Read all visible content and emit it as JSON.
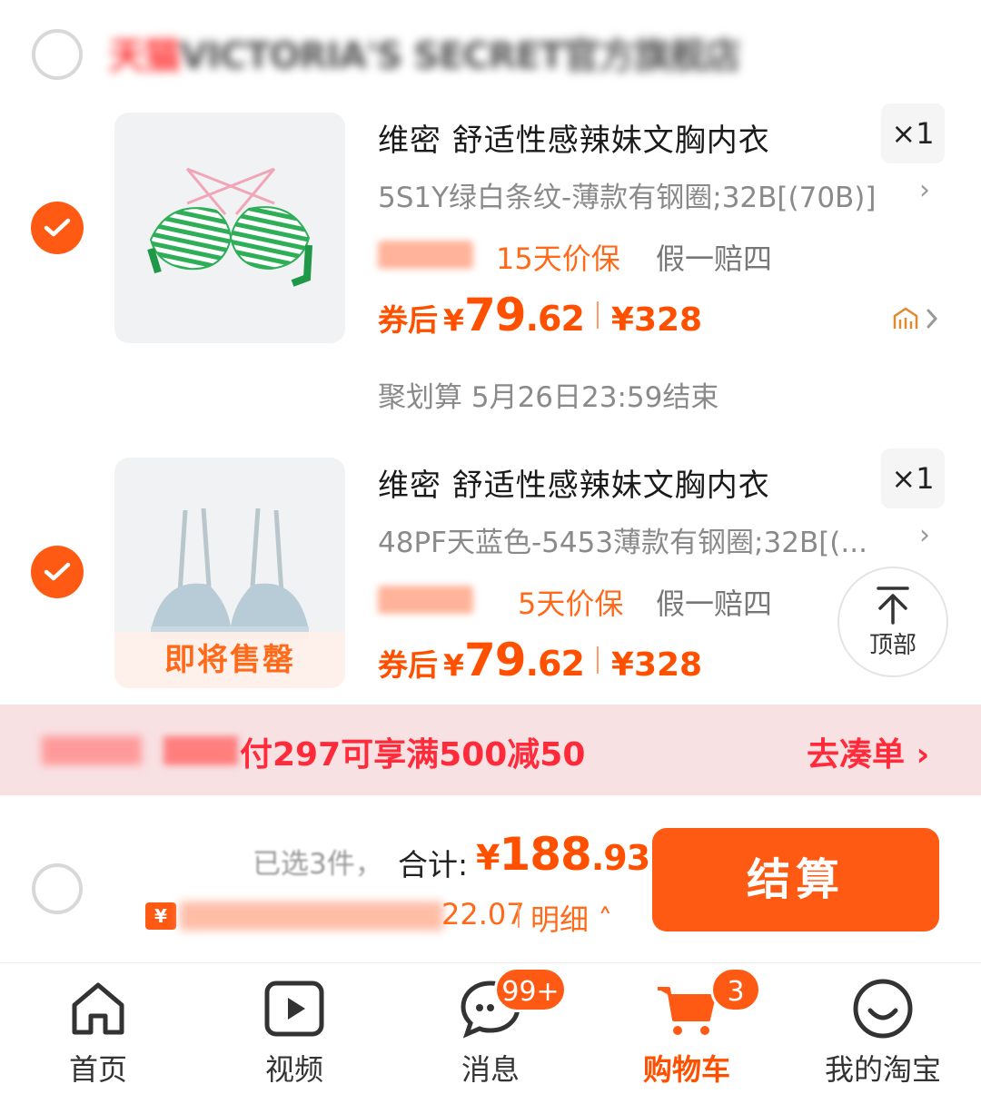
{
  "shop": {
    "name_prefix": "天猫",
    "name": "VICTORIA'S SECRET官方旗舰店"
  },
  "items": [
    {
      "title": "维密 舒适性感辣妹文胸内衣",
      "quantity": "×1",
      "sku": "5S1Y绿白条纹-薄款有钢圈;32B[(70B)]",
      "tag_price_protect": "15天价保",
      "tag_fake": "假一赔四",
      "price_prefix": "券后",
      "price_currency": "¥",
      "price_int": "79",
      "price_dec": ".62",
      "price_original": "¥328",
      "promo": "聚划算 5月26日23:59结束",
      "image_icon": "green-striped-bra-image",
      "selected": true
    },
    {
      "title": "维密 舒适性感辣妹文胸内衣",
      "quantity": "×1",
      "sku": "48PF天蓝色-5453薄款有钢圈;32B[(...",
      "tag_price_protect": "5天价保",
      "tag_fake": "假一赔四",
      "price_prefix": "券后",
      "price_currency": "¥",
      "price_int": "79",
      "price_dec": ".62",
      "price_original": "¥328",
      "soldout_label": "即将售罄",
      "image_icon": "light-blue-bra-image",
      "selected": true
    }
  ],
  "back_to_top": {
    "label": "顶部"
  },
  "promo_bar": {
    "text": "付297可享满500减50",
    "link": "去凑单"
  },
  "summary": {
    "selected_count": "已选3件，",
    "total_label": "合计:",
    "total_currency": "¥",
    "total_int": "188",
    "total_dec": ".93",
    "discount_badge": "¥",
    "discount_value": "22.07",
    "detail_label": "明细",
    "checkout_label": "结算"
  },
  "tabbar": {
    "tabs": [
      {
        "label": "首页",
        "icon": "home-icon"
      },
      {
        "label": "视频",
        "icon": "video-icon"
      },
      {
        "label": "消息",
        "icon": "message-icon",
        "badge": "99+"
      },
      {
        "label": "购物车",
        "icon": "cart-icon",
        "badge": "3",
        "active": true
      },
      {
        "label": "我的淘宝",
        "icon": "profile-icon"
      }
    ]
  },
  "colors": {
    "accent": "#ff5000",
    "check": "#ff5a14",
    "promo_bar_bg": "#f8e1e3",
    "promo_text": "#ff2a3a"
  }
}
